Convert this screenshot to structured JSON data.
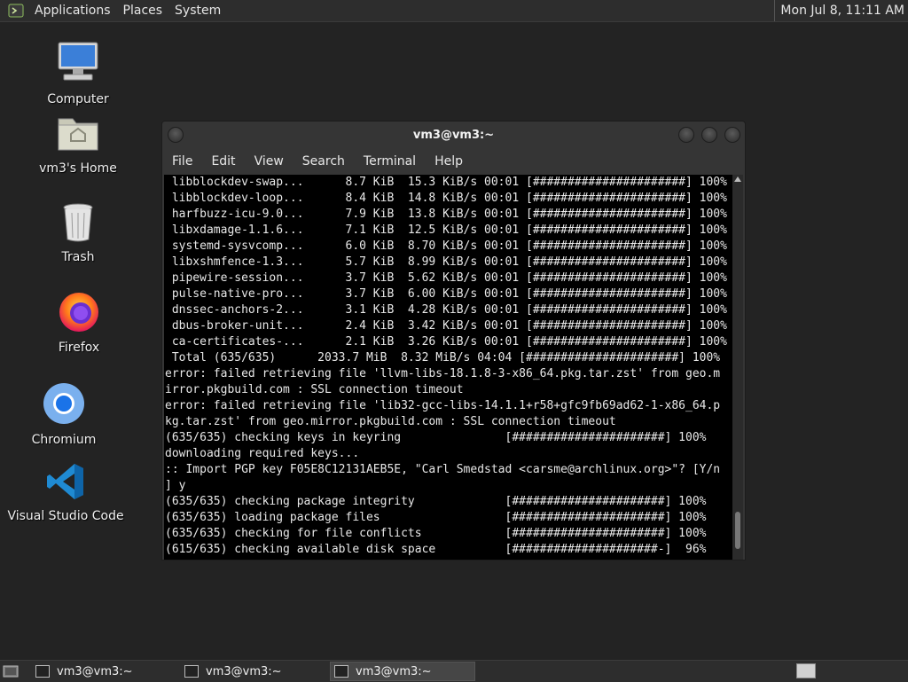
{
  "top_panel": {
    "menus": [
      "Applications",
      "Places",
      "System"
    ],
    "clock": "Mon Jul  8, 11:11 AM"
  },
  "desktop": {
    "icons": [
      {
        "label": "Computer",
        "icon": "computer-icon"
      },
      {
        "label": "vm3's Home",
        "icon": "home-folder-icon"
      },
      {
        "label": "Trash",
        "icon": "trash-icon"
      },
      {
        "label": "Firefox",
        "icon": "firefox-icon"
      },
      {
        "label": "Chromium",
        "icon": "chromium-icon"
      },
      {
        "label": "Visual Studio Code",
        "icon": "vscode-icon"
      }
    ]
  },
  "terminal": {
    "title": "vm3@vm3:~",
    "menu": [
      "File",
      "Edit",
      "View",
      "Search",
      "Terminal",
      "Help"
    ],
    "lines": [
      " libblockdev-swap...      8.7 KiB  15.3 KiB/s 00:01 [######################] 100%",
      " libblockdev-loop...      8.4 KiB  14.8 KiB/s 00:01 [######################] 100%",
      " harfbuzz-icu-9.0...      7.9 KiB  13.8 KiB/s 00:01 [######################] 100%",
      " libxdamage-1.1.6...      7.1 KiB  12.5 KiB/s 00:01 [######################] 100%",
      " systemd-sysvcomp...      6.0 KiB  8.70 KiB/s 00:01 [######################] 100%",
      " libxshmfence-1.3...      5.7 KiB  8.99 KiB/s 00:01 [######################] 100%",
      " pipewire-session...      3.7 KiB  5.62 KiB/s 00:01 [######################] 100%",
      " pulse-native-pro...      3.7 KiB  6.00 KiB/s 00:01 [######################] 100%",
      " dnssec-anchors-2...      3.1 KiB  4.28 KiB/s 00:01 [######################] 100%",
      " dbus-broker-unit...      2.4 KiB  3.42 KiB/s 00:01 [######################] 100%",
      " ca-certificates-...      2.1 KiB  3.26 KiB/s 00:01 [######################] 100%",
      " Total (635/635)      2033.7 MiB  8.32 MiB/s 04:04 [######################] 100%",
      "error: failed retrieving file 'llvm-libs-18.1.8-3-x86_64.pkg.tar.zst' from geo.m",
      "irror.pkgbuild.com : SSL connection timeout",
      "error: failed retrieving file 'lib32-gcc-libs-14.1.1+r58+gfc9fb69ad62-1-x86_64.p",
      "kg.tar.zst' from geo.mirror.pkgbuild.com : SSL connection timeout",
      "(635/635) checking keys in keyring               [######################] 100%",
      "downloading required keys...",
      ":: Import PGP key F05E8C12131AEB5E, \"Carl Smedstad <carsme@archlinux.org>\"? [Y/n",
      "] y",
      "(635/635) checking package integrity             [######################] 100%",
      "(635/635) loading package files                  [######################] 100%",
      "(635/635) checking for file conflicts            [######################] 100%",
      "(615/635) checking available disk space          [#####################-]  96%"
    ]
  },
  "taskbar": {
    "tasks": [
      {
        "label": "vm3@vm3:~"
      },
      {
        "label": "vm3@vm3:~"
      },
      {
        "label": "vm3@vm3:~"
      }
    ]
  }
}
